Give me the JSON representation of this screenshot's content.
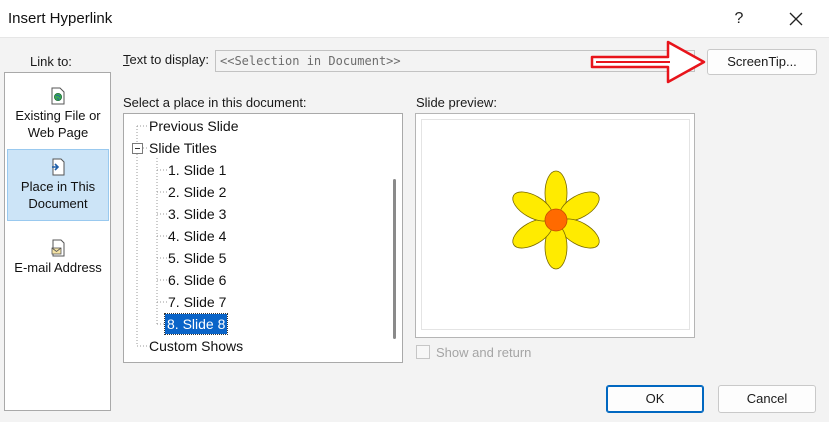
{
  "window": {
    "title": "Insert Hyperlink",
    "help_label": "?"
  },
  "link_to": {
    "label": "Link to:",
    "items": [
      {
        "label_line1": "Existing File or",
        "label_line2": "Web Page",
        "icon": "existing-file-icon",
        "selected": false
      },
      {
        "label_line1": "Place in This",
        "label_line2": "Document",
        "icon": "place-in-document-icon",
        "selected": true
      },
      {
        "label_line1": "E-mail Address",
        "label_line2": "",
        "icon": "email-icon",
        "selected": false
      }
    ]
  },
  "text_to_display": {
    "label_accel": "T",
    "label_rest": "ext to display:",
    "value": "<<Selection in Document>>"
  },
  "screentip": {
    "label": "ScreenTip..."
  },
  "place_list": {
    "label": "Select a place in this document:",
    "items": [
      {
        "label": "Previous Slide",
        "level": 0
      },
      {
        "label": "Slide Titles",
        "level": 0,
        "expanded": true
      },
      {
        "label": "1. Slide 1",
        "level": 1
      },
      {
        "label": "2. Slide 2",
        "level": 1
      },
      {
        "label": "3. Slide 3",
        "level": 1
      },
      {
        "label": "4. Slide 4",
        "level": 1
      },
      {
        "label": "5. Slide 5",
        "level": 1
      },
      {
        "label": "6. Slide 6",
        "level": 1
      },
      {
        "label": "7. Slide 7",
        "level": 1
      },
      {
        "label": "8. Slide 8",
        "level": 1,
        "selected": true
      },
      {
        "label": "Custom Shows",
        "level": 0
      }
    ]
  },
  "preview": {
    "label": "Slide preview:",
    "image": "flower-slide-thumbnail",
    "petal_color": "#ffeb00",
    "center_color": "#ff6a00"
  },
  "show_and_return": {
    "label": "Show and return",
    "checked": false,
    "enabled": false
  },
  "buttons": {
    "ok": "OK",
    "cancel": "Cancel"
  },
  "colors": {
    "accent": "#0067c0",
    "selection": "#0a64c8",
    "annotation_arrow": "#e8141b"
  }
}
